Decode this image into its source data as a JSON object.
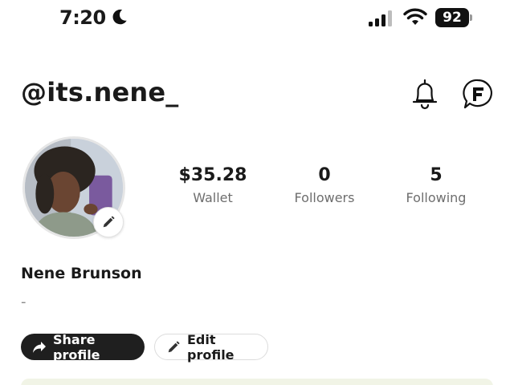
{
  "status_bar": {
    "time": "7:20",
    "battery_level": "92",
    "icons": [
      "moon-icon",
      "cellular-signal-icon",
      "wifi-icon",
      "battery-icon"
    ]
  },
  "header": {
    "username": "@its.nene_",
    "icons": [
      "bell-icon",
      "chat-icon"
    ]
  },
  "profile": {
    "display_name": "Nene Brunson",
    "bio": "-"
  },
  "stats": [
    {
      "value": "$35.28",
      "label": "Wallet"
    },
    {
      "value": "0",
      "label": "Followers"
    },
    {
      "value": "5",
      "label": "Following"
    }
  ],
  "actions": {
    "share_label": "Share profile",
    "edit_label": "Edit profile"
  },
  "colors": {
    "primary_button": "#1f1f1f",
    "muted_text": "#6e6e6e",
    "card_background": "#f1f4e6"
  }
}
